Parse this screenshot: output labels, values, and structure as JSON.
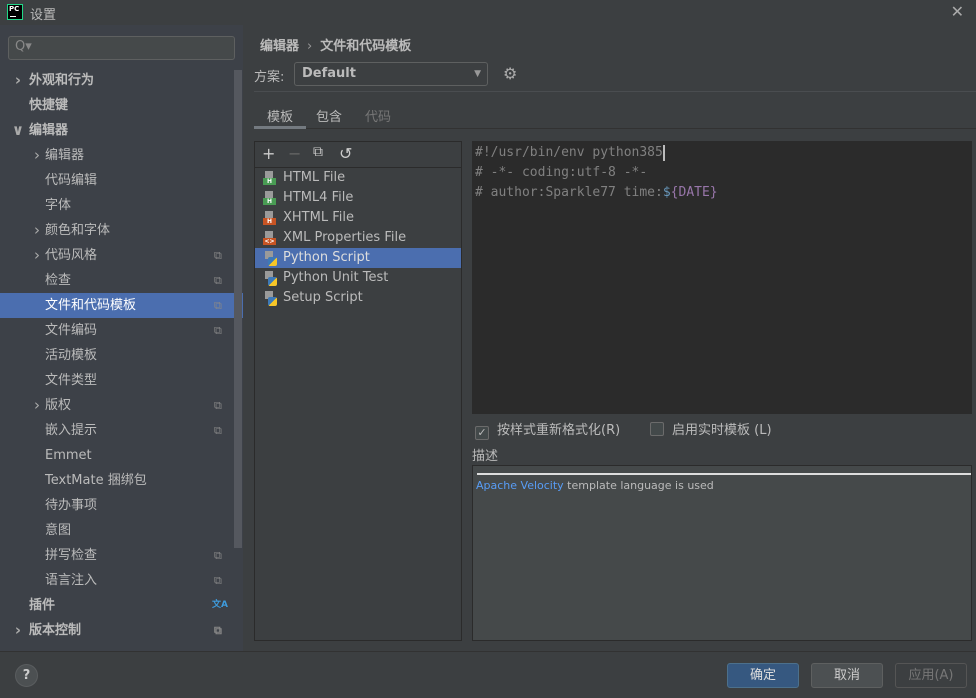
{
  "window": {
    "title": "设置",
    "logo": "PC"
  },
  "search": {
    "placeholder": "Q▾"
  },
  "sidebar": {
    "items": [
      {
        "label": "外观和行为",
        "level": 0,
        "arrow": "right",
        "bold": true
      },
      {
        "label": "快捷键",
        "level": 0,
        "bold": true
      },
      {
        "label": "编辑器",
        "level": 0,
        "arrow": "down",
        "bold": true
      },
      {
        "label": "编辑器",
        "level": 1,
        "arrow": "right"
      },
      {
        "label": "代码编辑",
        "level": 1
      },
      {
        "label": "字体",
        "level": 1
      },
      {
        "label": "颜色和字体",
        "level": 1,
        "arrow": "right"
      },
      {
        "label": "代码风格",
        "level": 1,
        "arrow": "right",
        "copy": true
      },
      {
        "label": "检查",
        "level": 1,
        "copy": true
      },
      {
        "label": "文件和代码模板",
        "level": 1,
        "copy": true,
        "selected": true
      },
      {
        "label": "文件编码",
        "level": 1,
        "copy": true
      },
      {
        "label": "活动模板",
        "level": 1
      },
      {
        "label": "文件类型",
        "level": 1
      },
      {
        "label": "版权",
        "level": 1,
        "arrow": "right",
        "copy": true
      },
      {
        "label": "嵌入提示",
        "level": 1,
        "copy": true
      },
      {
        "label": "Emmet",
        "level": 1
      },
      {
        "label": "TextMate 捆绑包",
        "level": 1
      },
      {
        "label": "待办事项",
        "level": 1
      },
      {
        "label": "意图",
        "level": 1
      },
      {
        "label": "拼写检查",
        "level": 1,
        "copy": true
      },
      {
        "label": "语言注入",
        "level": 1,
        "copy": true
      },
      {
        "label": "插件",
        "level": 0,
        "bold": true,
        "translate": true
      },
      {
        "label": "版本控制",
        "level": 0,
        "arrow": "right",
        "bold": true,
        "copy": true
      }
    ]
  },
  "breadcrumb": {
    "parent": "编辑器",
    "sep": "›",
    "current": "文件和代码模板"
  },
  "scheme": {
    "label": "方案:",
    "value": "Default"
  },
  "tabs": [
    {
      "label": "模板",
      "active": true
    },
    {
      "label": "包含"
    },
    {
      "label": "代码",
      "disabled": true
    }
  ],
  "toolbar": {
    "add": "+",
    "remove": "−",
    "copy": "⧉",
    "reset": "↺"
  },
  "templates": [
    {
      "name": "HTML File",
      "icon": "html",
      "tag": "H",
      "color": "#499c54"
    },
    {
      "name": "HTML4 File",
      "icon": "html",
      "tag": "H",
      "color": "#499c54"
    },
    {
      "name": "XHTML File",
      "icon": "html",
      "tag": "H",
      "color": "#c75424"
    },
    {
      "name": "XML Properties File",
      "icon": "xml",
      "tag": "<>",
      "color": "#c75424"
    },
    {
      "name": "Python Script",
      "icon": "python",
      "selected": true
    },
    {
      "name": "Python Unit Test",
      "icon": "python"
    },
    {
      "name": "Setup Script",
      "icon": "python"
    }
  ],
  "code": {
    "line1": "#!/usr/bin/env python385",
    "line2": "# -*- coding:utf-8 -*-",
    "line3_prefix": "# author:Sparkle77 time:",
    "line3_dollar": "$",
    "line3_var": "{DATE}"
  },
  "options": {
    "reformat": {
      "label": "按样式重新格式化(R)",
      "checked": true
    },
    "live": {
      "label": "启用实时模板 (L)",
      "checked": false
    }
  },
  "description": {
    "label": "描述",
    "link": "Apache Velocity",
    "text": " template language is used"
  },
  "buttons": {
    "ok": "确定",
    "cancel": "取消",
    "apply": "应用(A)",
    "help": "?"
  }
}
